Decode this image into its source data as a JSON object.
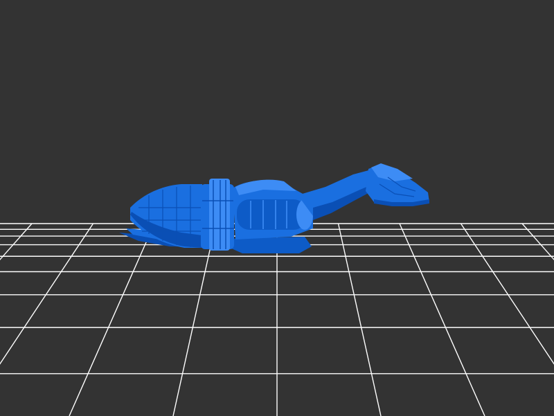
{
  "viewer": {
    "background_color": "#333333",
    "grid_color": "#ffffff",
    "model_color": "#1a6fe0",
    "model_highlight_color": "#3d8cf5",
    "model_shadow_color": "#0a4fb5"
  }
}
